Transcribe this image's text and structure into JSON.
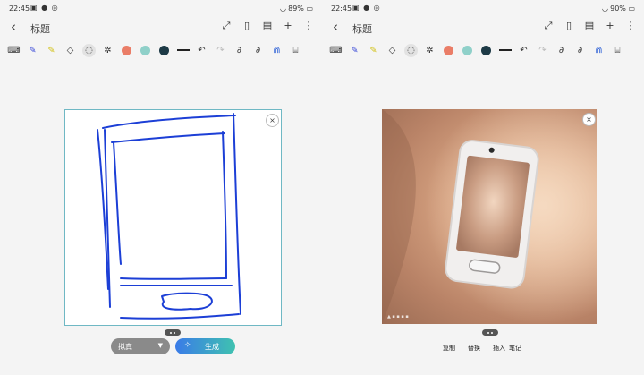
{
  "left": {
    "status": {
      "time": "22:45",
      "battery": "89%"
    },
    "title": "标题"
  },
  "right": {
    "status": {
      "time": "22:45",
      "battery": "90%"
    },
    "title": "标题"
  },
  "colors": {
    "coral": "#ea7d67",
    "teal": "#8fd0c9",
    "dark": "#1d3a46",
    "stroke": "#1c3fd6",
    "border": "#6fb8c4"
  },
  "icons": {
    "back": "‹",
    "expand": "⤢",
    "book": "▯",
    "doc": "▤",
    "add": "+",
    "more": "⋮",
    "close": "×",
    "sparkle": "✧"
  },
  "generate": {
    "style_label": "拟真",
    "button_label": "生成"
  },
  "actions": [
    "复制",
    "替换",
    "插入",
    "笔记"
  ]
}
